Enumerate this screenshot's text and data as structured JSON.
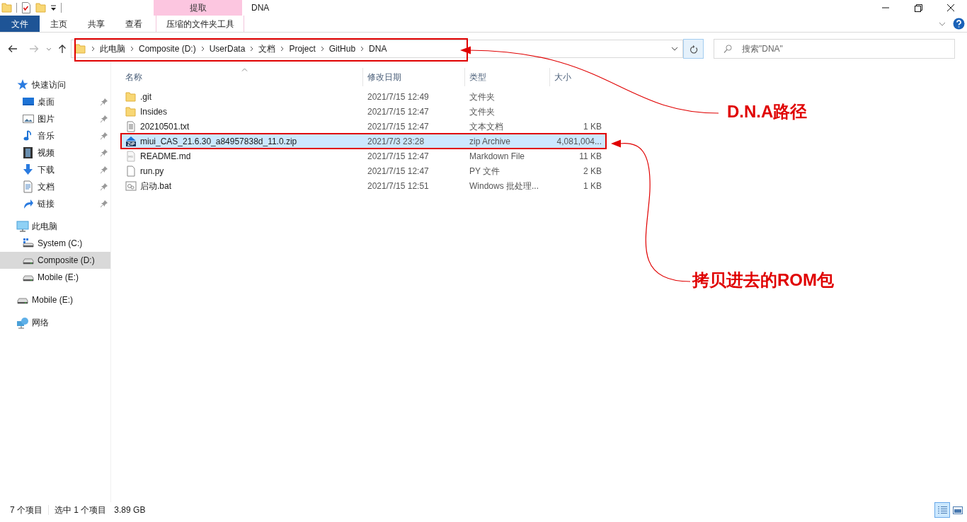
{
  "window": {
    "title": "DNA",
    "context_group": "提取"
  },
  "ribbon_tabs": [
    {
      "label": "文件",
      "kind": "file"
    },
    {
      "label": "主页",
      "kind": "tab"
    },
    {
      "label": "共享",
      "kind": "tab"
    },
    {
      "label": "查看",
      "kind": "tab"
    },
    {
      "label": "压缩的文件夹工具",
      "kind": "context"
    }
  ],
  "address": {
    "crumbs": [
      "此电脑",
      "Composite (D:)",
      "UserData",
      "文档",
      "Project",
      "GitHub",
      "DNA"
    ]
  },
  "search": {
    "placeholder": "搜索\"DNA\""
  },
  "sidebar": {
    "items": [
      {
        "label": "快速访问",
        "selected": false,
        "children": [
          {
            "label": "桌面",
            "pinned": true,
            "selected": false
          },
          {
            "label": "图片",
            "pinned": true,
            "selected": false
          },
          {
            "label": "音乐",
            "pinned": true,
            "selected": false
          },
          {
            "label": "视频",
            "pinned": true,
            "selected": false
          },
          {
            "label": "下载",
            "pinned": true,
            "selected": false
          },
          {
            "label": "文档",
            "pinned": true,
            "selected": false
          },
          {
            "label": "链接",
            "pinned": true,
            "selected": false
          }
        ]
      },
      {
        "label": "此电脑",
        "selected": false,
        "children": [
          {
            "label": "System (C:)",
            "selected": false
          },
          {
            "label": "Composite (D:)",
            "selected": true
          },
          {
            "label": "Mobile (E:)",
            "selected": false
          }
        ]
      },
      {
        "label": "Mobile (E:)",
        "selected": false
      },
      {
        "label": "网络",
        "selected": false
      }
    ]
  },
  "table": {
    "columns": [
      {
        "label": "名称",
        "sorted": true
      },
      {
        "label": "修改日期",
        "sorted": false
      },
      {
        "label": "类型",
        "sorted": false
      },
      {
        "label": "大小",
        "sorted": false
      }
    ],
    "rows": [
      {
        "name": ".git",
        "date": "2021/7/15 12:49",
        "type": "文件夹",
        "kind": "folder",
        "selected": false
      },
      {
        "name": "Insides",
        "date": "2021/7/15 12:47",
        "type": "文件夹",
        "kind": "folder",
        "selected": false
      },
      {
        "name": "20210501.txt",
        "date": "2021/7/15 12:47",
        "type": "文本文档",
        "size": "1 KB",
        "kind": "text",
        "selected": false
      },
      {
        "name": "miui_CAS_21.6.30_a84957838d_11.0.zip",
        "date": "2021/7/3 23:28",
        "type": "zip Archive",
        "size": "4,081,004...",
        "kind": "zip",
        "selected": true
      },
      {
        "name": "README.md",
        "date": "2021/7/15 12:47",
        "type": "Markdown File",
        "size": "11 KB",
        "kind": "markdown",
        "selected": false
      },
      {
        "name": "run.py",
        "date": "2021/7/15 12:47",
        "type": "PY 文件",
        "size": "2 KB",
        "kind": "file",
        "selected": false
      },
      {
        "name": "启动.bat",
        "date": "2021/7/15 12:51",
        "type": "Windows 批处理...",
        "size": "1 KB",
        "kind": "bat",
        "selected": false
      }
    ]
  },
  "status_bar": {
    "count": "7 个项目",
    "selection": "选中 1 个项目",
    "selection_size": "3.89 GB"
  },
  "annotations": [
    {
      "text": "D.N.A路径"
    },
    {
      "text": "拷贝进去的ROM包"
    }
  ]
}
